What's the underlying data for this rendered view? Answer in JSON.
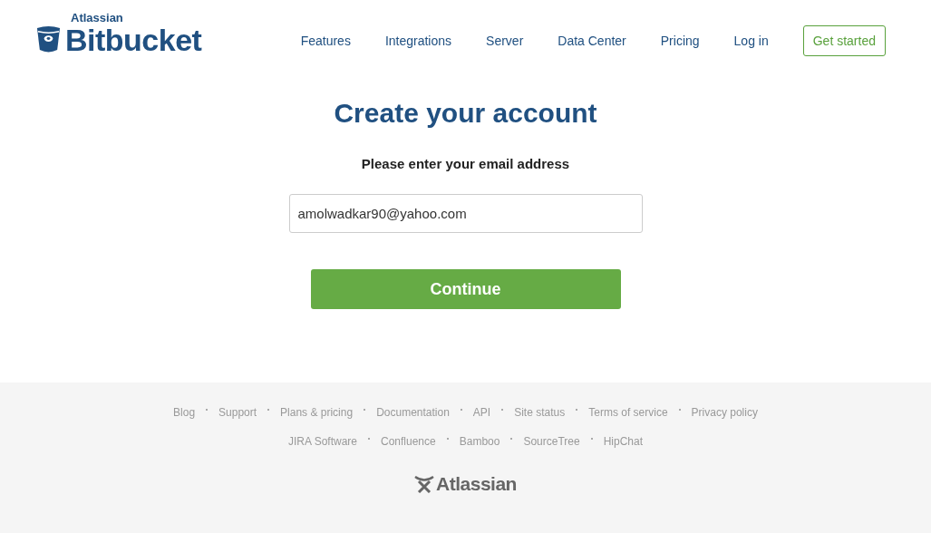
{
  "brand": {
    "company": "Atlassian",
    "product": "Bitbucket"
  },
  "nav": [
    "Features",
    "Integrations",
    "Server",
    "Data Center",
    "Pricing",
    "Log in"
  ],
  "cta": "Get started",
  "title": "Create your account",
  "prompt": "Please enter your email address",
  "email": {
    "value": "amolwadkar90@yahoo.com"
  },
  "submit": "Continue",
  "footer_links": [
    "Blog",
    "Support",
    "Plans & pricing",
    "Documentation",
    "API",
    "Site status",
    "Terms of service",
    "Privacy policy"
  ],
  "product_links": [
    "JIRA Software",
    "Confluence",
    "Bamboo",
    "SourceTree",
    "HipChat"
  ],
  "footer_logo": "Atlassian"
}
